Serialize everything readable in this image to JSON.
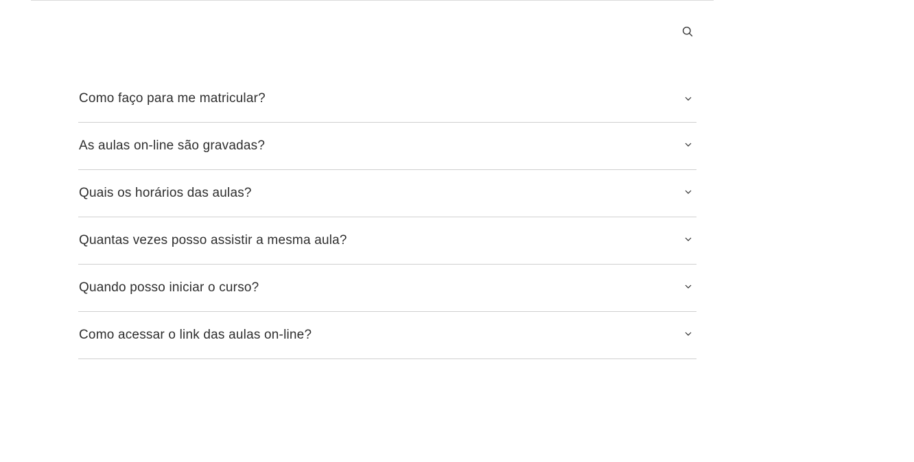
{
  "header": {
    "search_icon": "search-icon"
  },
  "faq": {
    "items": [
      {
        "question": "Como faço para me matricular?",
        "icon": "chevron-down-icon"
      },
      {
        "question": "As aulas on-line são gravadas?",
        "icon": "chevron-down-icon"
      },
      {
        "question": "Quais os horários das aulas?",
        "icon": "chevron-down-icon"
      },
      {
        "question": "Quantas vezes posso assistir a mesma aula?",
        "icon": "chevron-down-icon"
      },
      {
        "question": "Quando posso iniciar o curso?",
        "icon": "chevron-down-icon"
      },
      {
        "question": "Como acessar o link das aulas on-line?",
        "icon": "chevron-down-icon"
      }
    ]
  },
  "colors": {
    "text": "#2e2e2e",
    "divider": "#cfcfcf",
    "background": "#ffffff"
  }
}
